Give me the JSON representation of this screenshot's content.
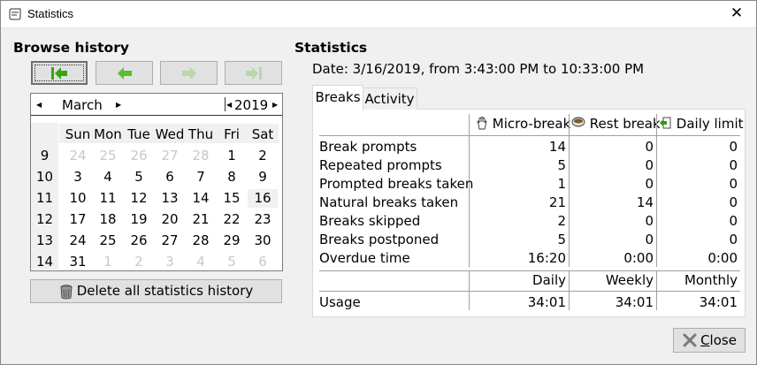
{
  "window": {
    "title": "Statistics",
    "close_glyph": "✕"
  },
  "left": {
    "heading": "Browse history",
    "nav_buttons": [
      "first-icon",
      "prev-icon",
      "next-icon",
      "last-icon"
    ],
    "calendar": {
      "month": "March",
      "year": "2019",
      "weekdays": [
        "Sun",
        "Mon",
        "Tue",
        "Wed",
        "Thu",
        "Fri",
        "Sat"
      ],
      "weeks": [
        "9",
        "10",
        "11",
        "12",
        "13",
        "14"
      ],
      "days": [
        [
          "24",
          "25",
          "26",
          "27",
          "28",
          "1",
          "2"
        ],
        [
          "3",
          "4",
          "5",
          "6",
          "7",
          "8",
          "9"
        ],
        [
          "10",
          "11",
          "12",
          "13",
          "14",
          "15",
          "16"
        ],
        [
          "17",
          "18",
          "19",
          "20",
          "21",
          "22",
          "23"
        ],
        [
          "24",
          "25",
          "26",
          "27",
          "28",
          "29",
          "30"
        ],
        [
          "31",
          "1",
          "2",
          "3",
          "4",
          "5",
          "6"
        ]
      ]
    },
    "delete_label": "Delete all statistics history"
  },
  "right": {
    "heading": "Statistics",
    "date_line": "Date: 3/16/2019, from 3:43:00 PM to 10:33:00 PM",
    "tabs": {
      "breaks": "Breaks",
      "activity": "Activity"
    },
    "columns": {
      "micro": "Micro-break",
      "rest": "Rest break",
      "daily": "Daily limit"
    },
    "rows": [
      {
        "label": "Break prompts",
        "micro": "14",
        "rest": "0",
        "daily": "0"
      },
      {
        "label": "Repeated prompts",
        "micro": "5",
        "rest": "0",
        "daily": "0"
      },
      {
        "label": "Prompted breaks taken",
        "micro": "1",
        "rest": "0",
        "daily": "0"
      },
      {
        "label": "Natural breaks taken",
        "micro": "21",
        "rest": "14",
        "daily": "0"
      },
      {
        "label": "Breaks skipped",
        "micro": "2",
        "rest": "0",
        "daily": "0"
      },
      {
        "label": "Breaks postponed",
        "micro": "5",
        "rest": "0",
        "daily": "0"
      },
      {
        "label": "Overdue time",
        "micro": "16:20",
        "rest": "0:00",
        "daily": "0:00"
      }
    ],
    "usage_columns": {
      "daily": "Daily",
      "weekly": "Weekly",
      "monthly": "Monthly"
    },
    "usage": {
      "label": "Usage",
      "daily": "34:01",
      "weekly": "34:01",
      "monthly": "34:01"
    }
  },
  "close_button": {
    "accel": "C",
    "rest": "lose"
  }
}
